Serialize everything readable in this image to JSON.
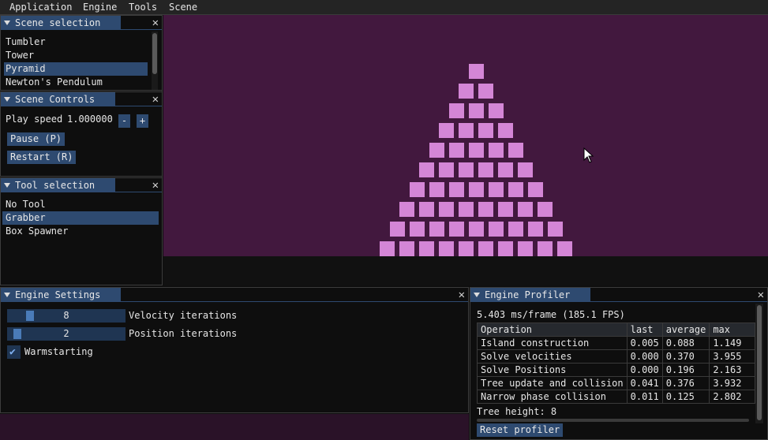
{
  "menu": [
    "Application",
    "Engine",
    "Tools",
    "Scene"
  ],
  "scene_selection": {
    "title": "Scene selection",
    "items": [
      "Tumbler",
      "Tower",
      "Pyramid",
      "Newton's Pendulum"
    ],
    "selected": "Pyramid"
  },
  "scene_controls": {
    "title": "Scene Controls",
    "play_speed_label": "Play speed",
    "play_speed_value": "1.000000",
    "minus_label": "-",
    "plus_label": "+",
    "pause_label": "Pause (P)",
    "restart_label": "Restart (R)"
  },
  "tool_selection": {
    "title": "Tool selection",
    "items": [
      "No Tool",
      "Grabber",
      "Box Spawner"
    ],
    "selected": "Grabber"
  },
  "engine_settings": {
    "title": "Engine Settings",
    "velocity_iterations": {
      "value": "8",
      "label": "Velocity iterations"
    },
    "position_iterations": {
      "value": "2",
      "label": "Position iterations"
    },
    "warmstarting": {
      "label": "Warmstarting",
      "checked": true
    }
  },
  "engine_profiler": {
    "title": "Engine Profiler",
    "frame_stats": "5.403 ms/frame (185.1 FPS)",
    "columns": [
      "Operation",
      "last",
      "average",
      "max"
    ],
    "rows": [
      [
        "Island construction",
        "0.005",
        "0.088",
        "1.149"
      ],
      [
        "Solve velocities",
        "0.000",
        "0.370",
        "3.955"
      ],
      [
        "Solve Positions",
        "0.000",
        "0.196",
        "2.163"
      ],
      [
        "Tree update and collision",
        "0.041",
        "0.376",
        "3.932"
      ],
      [
        "Narrow phase collision",
        "0.011",
        "0.125",
        "2.802"
      ]
    ],
    "tree_height": "Tree height: 8",
    "reset_label": "Reset profiler"
  },
  "pyramid": {
    "rows": 10,
    "colors": {
      "box": "#d486d6",
      "background": "#42183e"
    }
  },
  "colors": {
    "accent": "#2e4a70",
    "panel_bg": "#0e0e0e"
  },
  "icons": {
    "close": "close-icon",
    "collapse": "collapse-triangle-icon",
    "check": "checkmark-icon",
    "cursor": "mouse-cursor-icon"
  }
}
